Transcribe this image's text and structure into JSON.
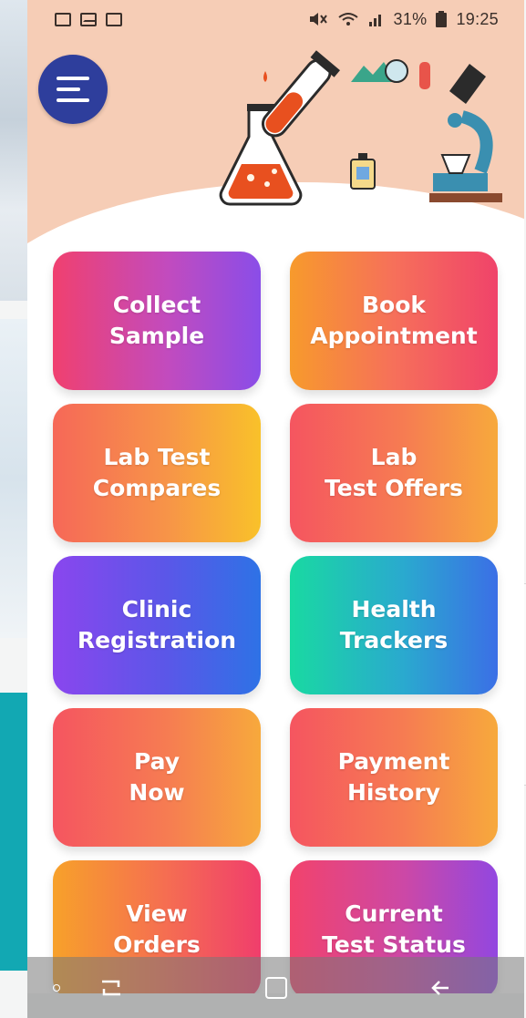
{
  "status_bar": {
    "left_icons": [
      "app-notification-icon",
      "mail-icon",
      "calendar-icon"
    ],
    "right_icons": [
      "mute-icon",
      "wifi-icon",
      "signal-icon",
      "battery-icon"
    ],
    "battery": "31%",
    "time": "19:25"
  },
  "header": {
    "menu_icon": "hamburger-menu-icon",
    "illustration": "lab-equipment-illustration",
    "background_color": "#f6cdb6",
    "menu_color": "#2e3e9c"
  },
  "tiles": [
    {
      "label": "Collect\nSample"
    },
    {
      "label": "Book\nAppointment"
    },
    {
      "label": "Lab Test\nCompares"
    },
    {
      "label": "Lab\nTest Offers"
    },
    {
      "label": "Clinic\nRegistration"
    },
    {
      "label": "Health\nTrackers"
    },
    {
      "label": "Pay\nNow"
    },
    {
      "label": "Payment\nHistory"
    },
    {
      "label": "View\nOrders"
    },
    {
      "label": "Current\nTest Status"
    }
  ],
  "nav_bar": {
    "icons": [
      "recent-apps-icon",
      "home-icon",
      "back-icon"
    ]
  }
}
